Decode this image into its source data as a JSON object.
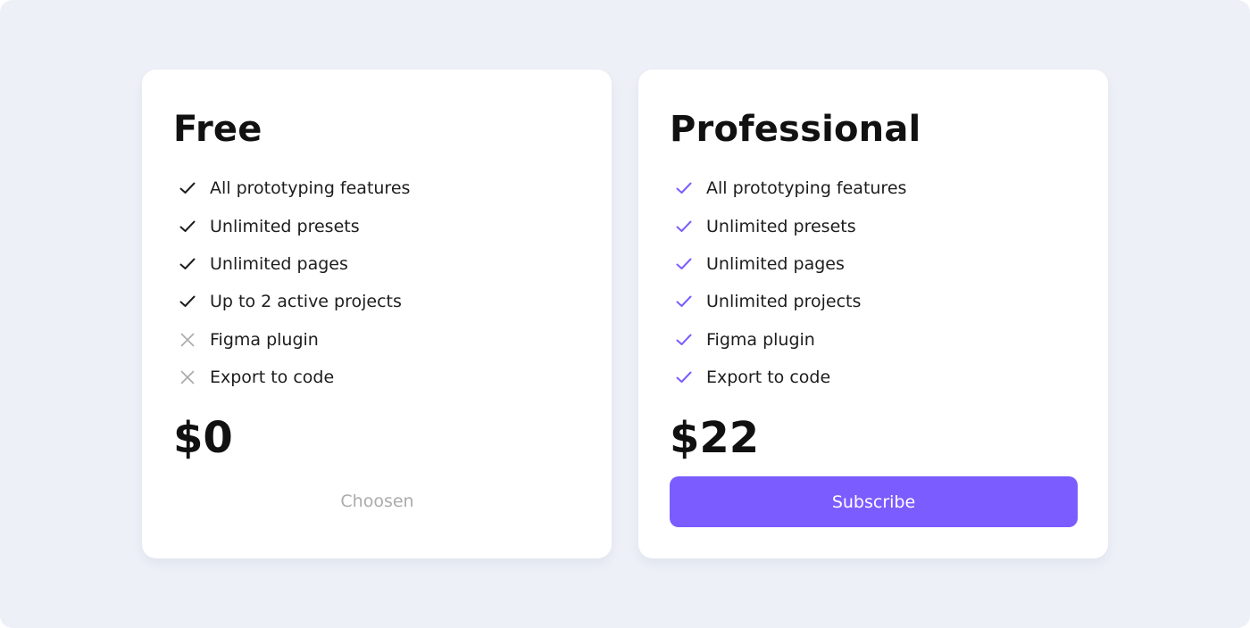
{
  "colors": {
    "background": "#edf0f7",
    "card": "#ffffff",
    "accent": "#7b5cff",
    "text_primary": "#111111",
    "text_muted": "#ababab",
    "icon_dark": "#1d1d1d",
    "icon_muted": "#a9a9a9"
  },
  "plans": [
    {
      "name": "Free",
      "price": "$0",
      "action_label": "Choosen",
      "features": [
        {
          "label": "All prototyping features",
          "icon": "check-icon"
        },
        {
          "label": "Unlimited presets",
          "icon": "check-icon"
        },
        {
          "label": "Unlimited pages",
          "icon": "check-icon"
        },
        {
          "label": "Up to 2 active projects",
          "icon": "check-icon"
        },
        {
          "label": "Figma plugin",
          "icon": "x-icon"
        },
        {
          "label": "Export to code",
          "icon": "x-icon"
        }
      ]
    },
    {
      "name": "Professional",
      "price": "$22",
      "action_label": "Subscribe",
      "features": [
        {
          "label": "All prototyping features",
          "icon": "check-icon"
        },
        {
          "label": "Unlimited presets",
          "icon": "check-icon"
        },
        {
          "label": "Unlimited pages",
          "icon": "check-icon"
        },
        {
          "label": "Unlimited projects",
          "icon": "check-icon"
        },
        {
          "label": "Figma plugin",
          "icon": "check-icon"
        },
        {
          "label": "Export to code",
          "icon": "check-icon"
        }
      ]
    }
  ]
}
